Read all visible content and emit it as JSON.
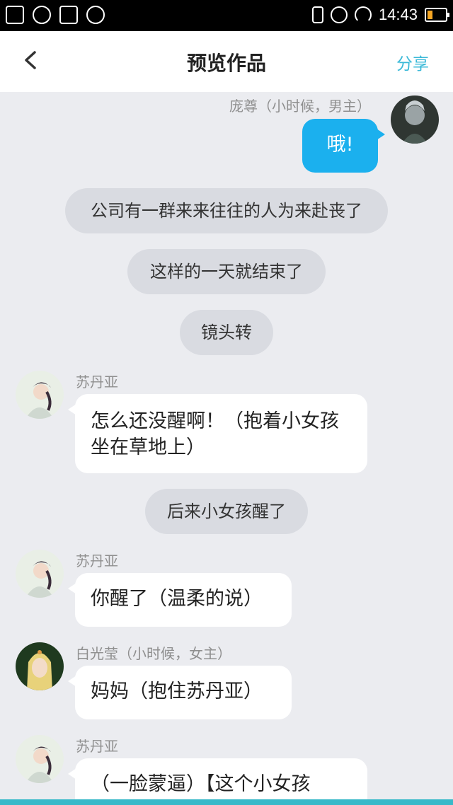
{
  "status_bar": {
    "time": "14:43"
  },
  "header": {
    "title": "预览作品",
    "share_label": "分享"
  },
  "messages": [
    {
      "type": "right",
      "name": "庞尊（小时候，男主）",
      "text": "哦!"
    },
    {
      "type": "narration",
      "text": "公司有一群来来往往的人为来赴丧了"
    },
    {
      "type": "narration",
      "text": "这样的一天就结束了"
    },
    {
      "type": "narration",
      "text": "镜头转"
    },
    {
      "type": "left",
      "name": "苏丹亚",
      "text": "怎么还没醒啊！（抱着小女孩坐在草地上）"
    },
    {
      "type": "narration",
      "text": "后来小女孩醒了"
    },
    {
      "type": "left",
      "name": "苏丹亚",
      "text": "你醒了（温柔的说）"
    },
    {
      "type": "left",
      "name": "白光莹（小时候，女主）",
      "text": "妈妈（抱住苏丹亚）"
    },
    {
      "type": "left",
      "name": "苏丹亚",
      "text": "（一脸蒙逼）【这个小女孩"
    }
  ],
  "colors": {
    "accent": "#3bb9d8",
    "bubble_right": "#1bb0ee",
    "background": "#ebecf0"
  }
}
